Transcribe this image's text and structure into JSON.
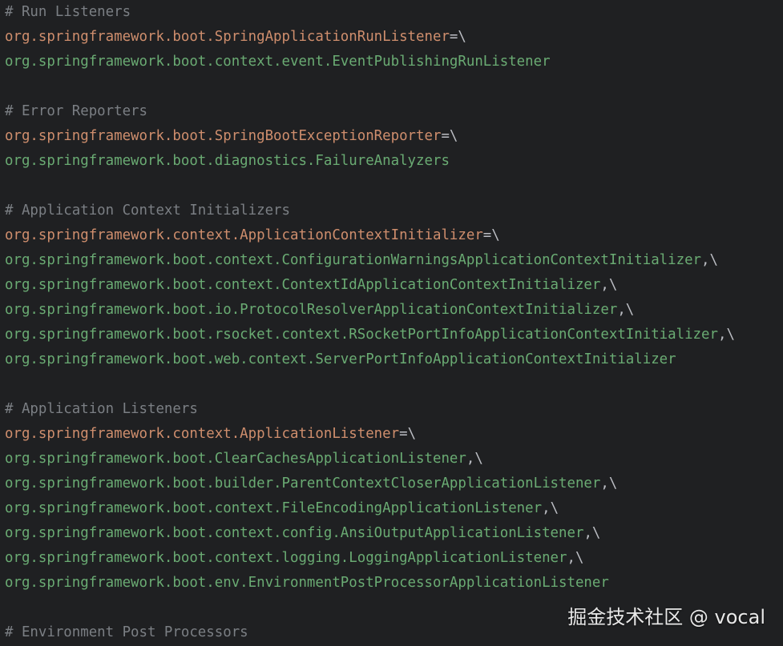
{
  "editor": {
    "colors": {
      "background": "#1f2022",
      "comment": "#7b7f84",
      "key": "#cf8e6d",
      "value": "#6aab73",
      "punctuation": "#bcbec4"
    },
    "lines": [
      {
        "type": "comment",
        "text": "# Run Listeners"
      },
      {
        "type": "key",
        "text": "org.springframework.boot.SpringApplicationRunListener",
        "suffix": "=\\"
      },
      {
        "type": "value",
        "text": "org.springframework.boot.context.event.EventPublishingRunListener",
        "suffix": ""
      },
      {
        "type": "blank",
        "text": ""
      },
      {
        "type": "comment",
        "text": "# Error Reporters"
      },
      {
        "type": "key",
        "text": "org.springframework.boot.SpringBootExceptionReporter",
        "suffix": "=\\"
      },
      {
        "type": "value",
        "text": "org.springframework.boot.diagnostics.FailureAnalyzers",
        "suffix": ""
      },
      {
        "type": "blank",
        "text": ""
      },
      {
        "type": "comment",
        "text": "# Application Context Initializers"
      },
      {
        "type": "key",
        "text": "org.springframework.context.ApplicationContextInitializer",
        "suffix": "=\\"
      },
      {
        "type": "value",
        "text": "org.springframework.boot.context.ConfigurationWarningsApplicationContextInitializer",
        "suffix": ",\\"
      },
      {
        "type": "value",
        "text": "org.springframework.boot.context.ContextIdApplicationContextInitializer",
        "suffix": ",\\"
      },
      {
        "type": "value",
        "text": "org.springframework.boot.io.ProtocolResolverApplicationContextInitializer",
        "suffix": ",\\"
      },
      {
        "type": "value",
        "text": "org.springframework.boot.rsocket.context.RSocketPortInfoApplicationContextInitializer",
        "suffix": ",\\"
      },
      {
        "type": "value",
        "text": "org.springframework.boot.web.context.ServerPortInfoApplicationContextInitializer",
        "suffix": ""
      },
      {
        "type": "blank",
        "text": ""
      },
      {
        "type": "comment",
        "text": "# Application Listeners"
      },
      {
        "type": "key",
        "text": "org.springframework.context.ApplicationListener",
        "suffix": "=\\"
      },
      {
        "type": "value",
        "text": "org.springframework.boot.ClearCachesApplicationListener",
        "suffix": ",\\"
      },
      {
        "type": "value",
        "text": "org.springframework.boot.builder.ParentContextCloserApplicationListener",
        "suffix": ",\\"
      },
      {
        "type": "value",
        "text": "org.springframework.boot.context.FileEncodingApplicationListener",
        "suffix": ",\\"
      },
      {
        "type": "value",
        "text": "org.springframework.boot.context.config.AnsiOutputApplicationListener",
        "suffix": ",\\"
      },
      {
        "type": "value",
        "text": "org.springframework.boot.context.logging.LoggingApplicationListener",
        "suffix": ",\\"
      },
      {
        "type": "value",
        "text": "org.springframework.boot.env.EnvironmentPostProcessorApplicationListener",
        "suffix": ""
      },
      {
        "type": "blank",
        "text": ""
      },
      {
        "type": "comment",
        "text": "# Environment Post Processors"
      }
    ]
  },
  "watermark": {
    "text": "掘金技术社区 @ vocal"
  }
}
